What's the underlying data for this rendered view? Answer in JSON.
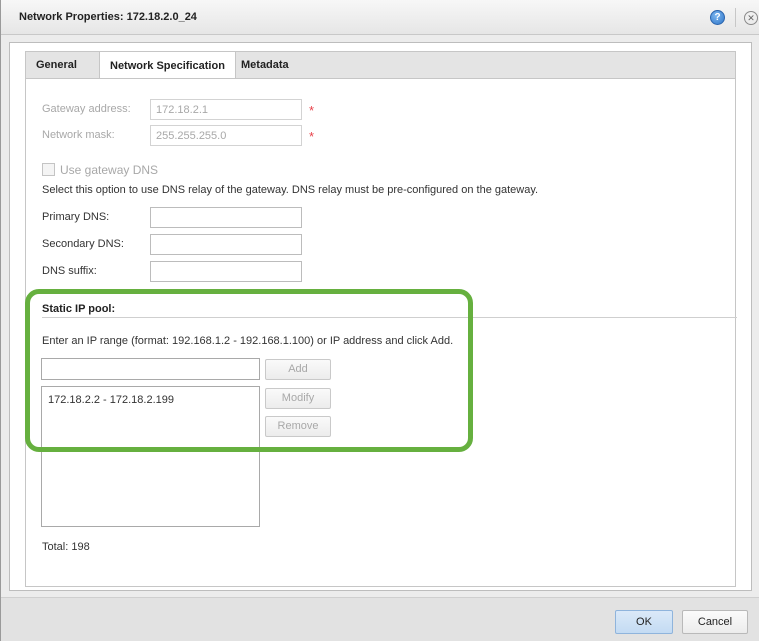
{
  "window": {
    "title": "Network Properties: 172.18.2.0_24",
    "help_icon": "help-icon",
    "help_glyph": "?",
    "close_icon": "close-icon",
    "close_glyph": "✕"
  },
  "tabs": [
    {
      "label": "General"
    },
    {
      "label": "Network Specification",
      "active": true
    },
    {
      "label": "Metadata"
    }
  ],
  "form": {
    "gateway_label": "Gateway address:",
    "gateway_value": "172.18.2.1",
    "mask_label": "Network mask:",
    "mask_value": "255.255.255.0",
    "required_mark": "*",
    "use_gateway_dns_label": "Use gateway DNS",
    "use_gateway_dns_checked": false,
    "dns_help": "Select this option to use DNS relay of the gateway. DNS relay must be pre-configured on the gateway.",
    "primary_dns_label": "Primary DNS:",
    "primary_dns_value": "",
    "secondary_dns_label": "Secondary DNS:",
    "secondary_dns_value": "",
    "dns_suffix_label": "DNS suffix:",
    "dns_suffix_value": ""
  },
  "static_ip_pool": {
    "title": "Static IP pool:",
    "instructions": "Enter an IP range (format: 192.168.1.2 - 192.168.1.100) or IP address and click Add.",
    "input_value": "",
    "add_label": "Add",
    "modify_label": "Modify",
    "remove_label": "Remove",
    "items": [
      "172.18.2.2 - 172.18.2.199"
    ],
    "total": "Total: 198"
  },
  "footer": {
    "ok_label": "OK",
    "cancel_label": "Cancel"
  },
  "colors": {
    "highlight": "#66b03f",
    "required": "#e8414a",
    "ok_button": "#c3dbf3"
  }
}
